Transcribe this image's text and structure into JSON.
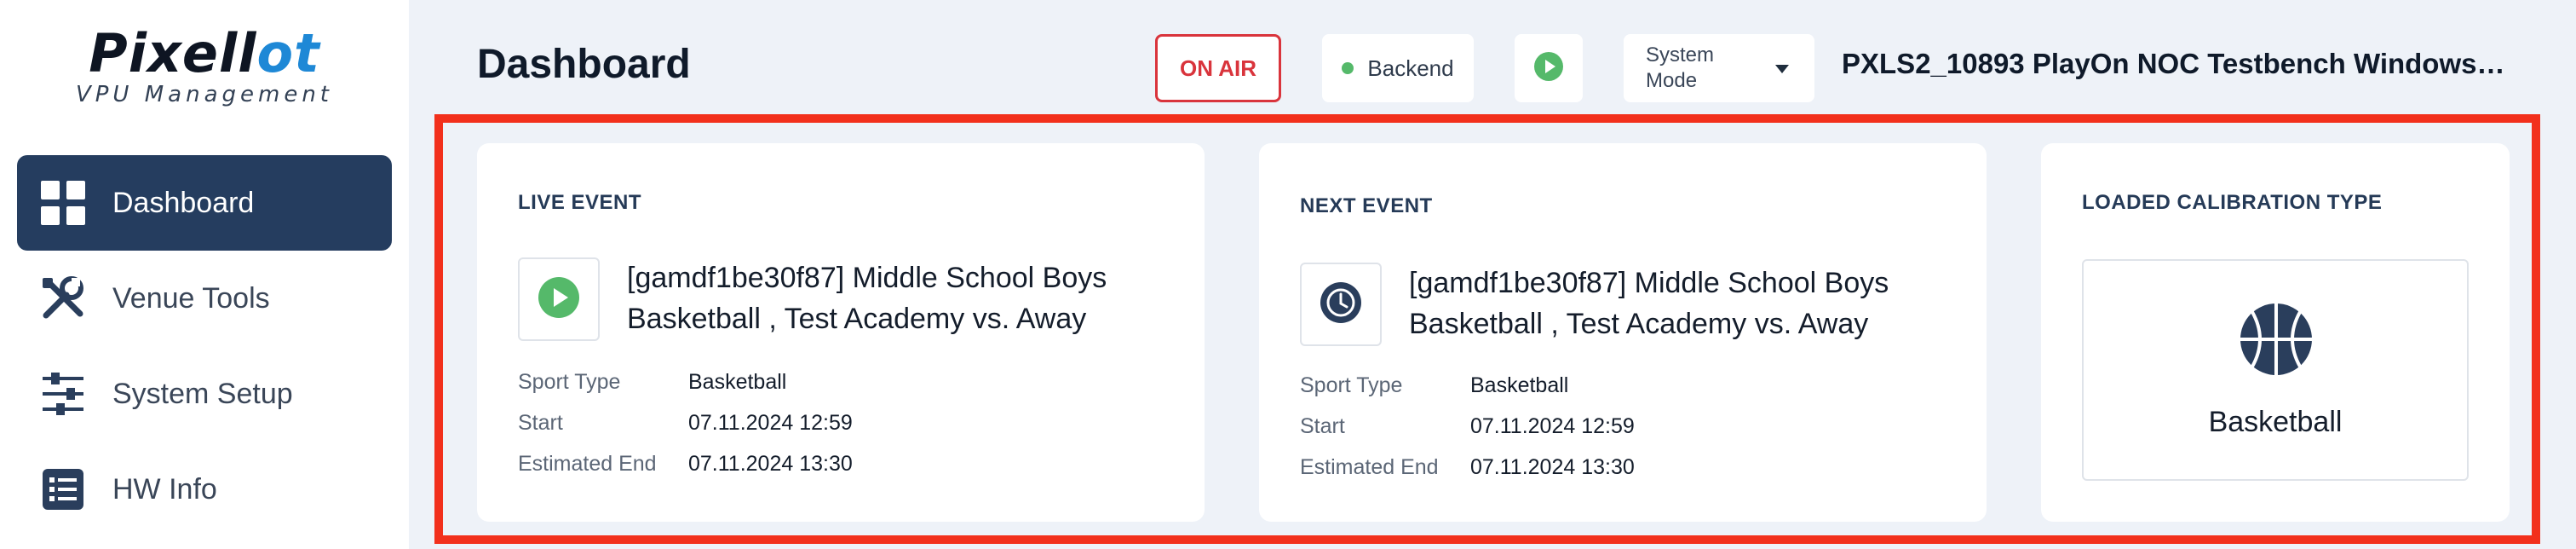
{
  "brand": {
    "logo_text_part1": "Pixell",
    "logo_text_part2": "o",
    "logo_text_part3": "t",
    "subtitle": "VPU Management",
    "accent_color": "#1e88d6"
  },
  "sidebar": {
    "items": [
      {
        "label": "Dashboard",
        "icon": "grid-icon",
        "active": true
      },
      {
        "label": "Venue Tools",
        "icon": "tools-icon",
        "active": false
      },
      {
        "label": "System Setup",
        "icon": "sliders-icon",
        "active": false
      },
      {
        "label": "HW Info",
        "icon": "list-icon",
        "active": false
      }
    ],
    "active_color": "#253d5f"
  },
  "header": {
    "title": "Dashboard",
    "on_air_label": "ON AIR",
    "backend_label": "Backend",
    "backend_status_color": "#55b96a",
    "system_mode_label": "System Mode",
    "device_name": "PXLS2_10893 PlayOn NOC Testbench Windows_I..."
  },
  "live_event": {
    "title": "LIVE EVENT",
    "event_name_line1": "[gamdf1be30f87] Middle School Boys",
    "event_name_line2": "Basketball , Test Academy vs. Away",
    "icon": "play-icon",
    "details": [
      {
        "key": "Sport Type",
        "value": "Basketball"
      },
      {
        "key": "Start",
        "value": "07.11.2024 12:59"
      },
      {
        "key": "Estimated End",
        "value": "07.11.2024 13:30"
      }
    ]
  },
  "next_event": {
    "title": "NEXT EVENT",
    "event_name_line1": "[gamdf1be30f87] Middle School Boys",
    "event_name_line2": "Basketball , Test Academy vs. Away",
    "icon": "clock-icon",
    "details": [
      {
        "key": "Sport Type",
        "value": "Basketball"
      },
      {
        "key": "Start",
        "value": "07.11.2024 12:59"
      },
      {
        "key": "Estimated End",
        "value": "07.11.2024 13:30"
      }
    ]
  },
  "calibration": {
    "title": "LOADED CALIBRATION TYPE",
    "type_label": "Basketball",
    "icon": "basketball-icon"
  },
  "highlight_color": "#f2301c"
}
